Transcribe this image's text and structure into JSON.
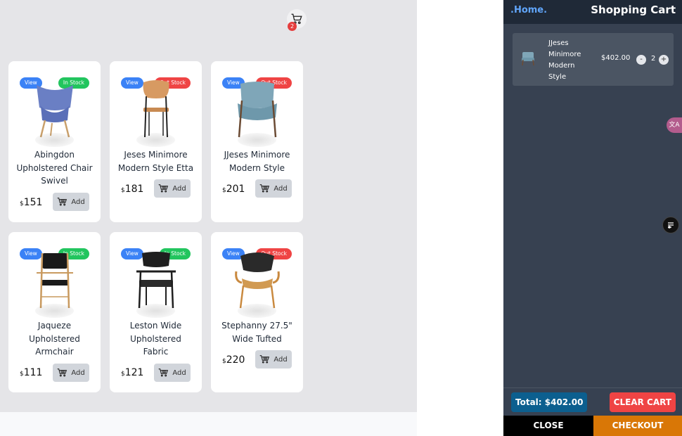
{
  "cart_button": {
    "count": "2"
  },
  "products": [
    {
      "view_label": "View",
      "stock_label": "In Stock",
      "name": "Abingdon Upholstered Chair Swivel",
      "currency": "$",
      "price": "151",
      "add_label": "Add"
    },
    {
      "view_label": "View",
      "stock_label": "Out Stock",
      "name": "Jeses Minimore Modern Style Etta",
      "currency": "$",
      "price": "181",
      "add_label": "Add"
    },
    {
      "view_label": "View",
      "stock_label": "Out Stock",
      "name": "JJeses Minimore Modern Style",
      "currency": "$",
      "price": "201",
      "add_label": "Add"
    },
    {
      "view_label": "View",
      "stock_label": "In Stock",
      "name": "Jaqueze Upholstered Armchair",
      "currency": "$",
      "price": "111",
      "add_label": "Add"
    },
    {
      "view_label": "View",
      "stock_label": "In Stock",
      "name": "Leston Wide Upholstered Fabric",
      "currency": "$",
      "price": "121",
      "add_label": "Add"
    },
    {
      "view_label": "View",
      "stock_label": "Out Stock",
      "name": "Stephanny 27.5\" Wide Tufted",
      "currency": "$",
      "price": "220",
      "add_label": "Add"
    }
  ],
  "cart": {
    "home_link": ".Home.",
    "title": "Shopping Cart",
    "items": [
      {
        "name": "JJeses Minimore Modern Style",
        "price": "$402.00",
        "qty": "2",
        "minus": "-",
        "plus": "+"
      }
    ],
    "total_label": "Total: $402.00",
    "clear_label": "CLEAR CART",
    "close_label": "CLOSE",
    "checkout_label": "CHECKOUT"
  },
  "colors": {
    "view_badge": "#3b82f6",
    "in_stock": "#22c55e",
    "out_stock": "#ef4444",
    "cart_panel": "#374151",
    "checkout": "#d97706"
  },
  "icons": {
    "cart": "shopping-cart-icon",
    "translate": "translate-icon",
    "tool": "toolbar-icon"
  }
}
